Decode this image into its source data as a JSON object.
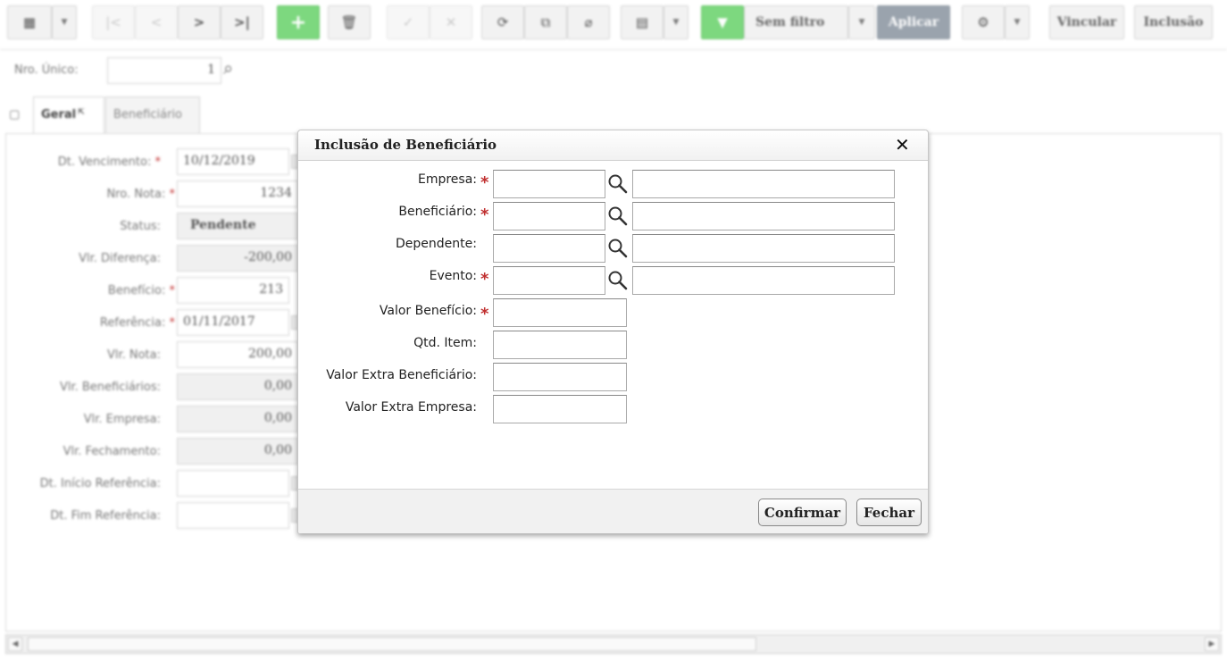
{
  "toolbar": {
    "filter_label": "Sem filtro",
    "apply_label": "Aplicar",
    "link_label": "Vincular",
    "insert_label": "Inclusão"
  },
  "record": {
    "id_label": "Nro. Único:",
    "id_value": "1"
  },
  "tabs": [
    {
      "label": "Geral",
      "active": true
    },
    {
      "label": "Beneficiário",
      "active": false
    }
  ],
  "form": {
    "fields": [
      {
        "label": "Dt. Vencimento:",
        "required": true,
        "value": "10/12/2019"
      },
      {
        "label": "Nro. Nota:",
        "required": true,
        "value": "1234"
      },
      {
        "label": "Status:",
        "required": false,
        "value": "Pendente"
      },
      {
        "label": "Vlr. Diferença:",
        "required": false,
        "value": "-200,00"
      },
      {
        "label": "Benefício:",
        "required": true,
        "value": "213"
      },
      {
        "label": "Referência:",
        "required": true,
        "value": "01/11/2017"
      },
      {
        "label": "Vlr. Nota:",
        "required": false,
        "value": "200,00"
      },
      {
        "label": "Vlr. Beneficiários:",
        "required": false,
        "value": "0,00"
      },
      {
        "label": "Vlr. Empresa:",
        "required": false,
        "value": "0,00"
      },
      {
        "label": "Vlr. Fechamento:",
        "required": false,
        "value": "0,00"
      },
      {
        "label": "Dt. Início Referência:",
        "required": false,
        "value": ""
      },
      {
        "label": "Dt. Fim Referência:",
        "required": false,
        "value": ""
      }
    ]
  },
  "modal": {
    "title": "Inclusão de Beneficiário",
    "fields": [
      {
        "label": "Empresa:",
        "required": true,
        "value": "",
        "description": ""
      },
      {
        "label": "Beneficiário:",
        "required": true,
        "value": "",
        "description": ""
      },
      {
        "label": "Dependente:",
        "required": false,
        "value": "",
        "description": ""
      },
      {
        "label": "Evento:",
        "required": true,
        "value": "",
        "description": ""
      },
      {
        "label": "Valor Benefício:",
        "required": true,
        "value": ""
      },
      {
        "label": "Qtd. Item:",
        "required": false,
        "value": ""
      },
      {
        "label": "Valor Extra Beneficiário:",
        "required": false,
        "value": ""
      },
      {
        "label": "Valor Extra Empresa:",
        "required": false,
        "value": ""
      }
    ],
    "confirm_label": "Confirmar",
    "close_label": "Fechar"
  },
  "colors": {
    "add_button": "#7dd87f",
    "filter_button": "#7dd87f",
    "apply_button": "#9aa3ad",
    "required_marker": "#c03030"
  }
}
